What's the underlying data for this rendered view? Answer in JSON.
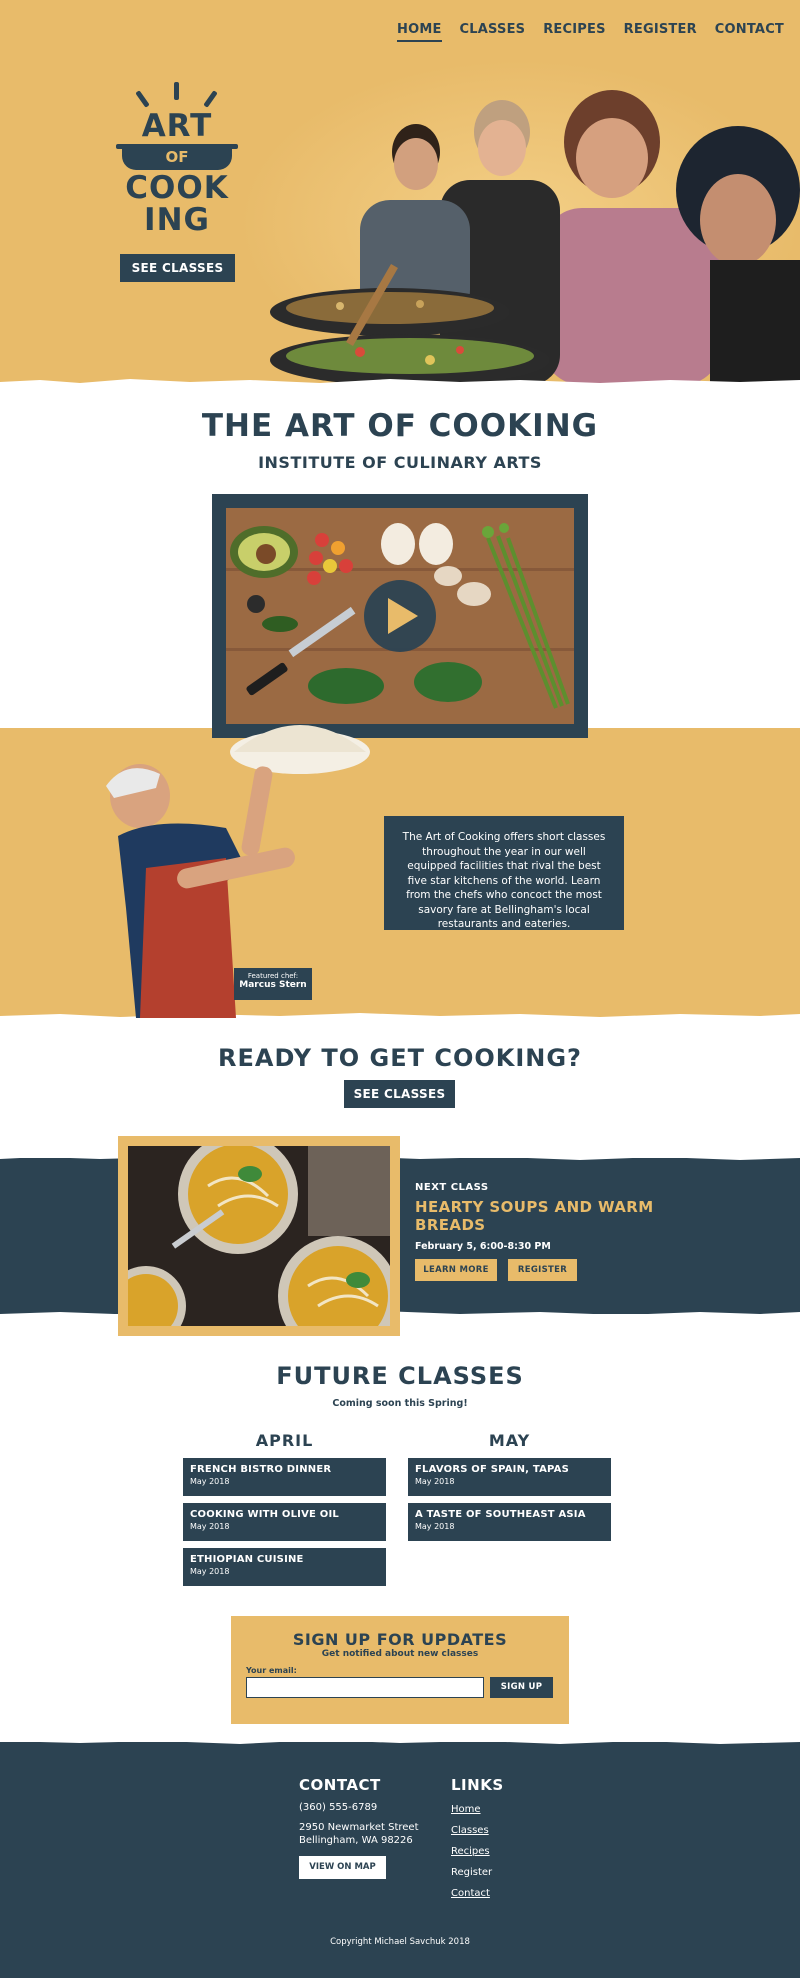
{
  "nav": {
    "items": [
      {
        "label": "HOME",
        "active": true
      },
      {
        "label": "CLASSES"
      },
      {
        "label": "RECIPES"
      },
      {
        "label": "REGISTER"
      },
      {
        "label": "CONTACT"
      }
    ]
  },
  "hero": {
    "logo_line1": "ART",
    "logo_line2": "OF",
    "logo_line3": "COOK",
    "logo_line4": "ING",
    "cta": "SEE CLASSES"
  },
  "intro": {
    "title": "THE ART OF COOKING",
    "subtitle": "INSTITUTE OF CULINARY ARTS"
  },
  "about": {
    "text": "The Art of Cooking offers short classes throughout the year in our well equipped facilities that rival the best five star kitchens of the world. Learn from the chefs who concoct the most savory fare at Bellingham's local restaurants and eateries.",
    "caption_label": "Featured chef:",
    "caption_name": "Marcus Stern"
  },
  "ready": {
    "title": "READY TO GET COOKING?",
    "cta": "SEE CLASSES"
  },
  "next_class": {
    "kicker": "NEXT CLASS",
    "title_line1": "HEARTY SOUPS AND WARM",
    "title_line2": "BREADS",
    "date": "February 5, 6:00-8:30 PM",
    "learn_more": "LEARN MORE",
    "register": "REGISTER"
  },
  "future": {
    "title": "FUTURE CLASSES",
    "subtitle": "Coming soon this Spring!",
    "april": {
      "label": "APRIL",
      "classes": [
        {
          "title": "FRENCH BISTRO DINNER",
          "date": "May 2018"
        },
        {
          "title": "COOKING WITH OLIVE OIL",
          "date": "May 2018"
        },
        {
          "title": "ETHIOPIAN CUISINE",
          "date": "May 2018"
        }
      ]
    },
    "may": {
      "label": "MAY",
      "classes": [
        {
          "title": "FLAVORS OF SPAIN, TAPAS",
          "date": "May 2018"
        },
        {
          "title": "A TASTE OF SOUTHEAST ASIA",
          "date": "May 2018"
        }
      ]
    }
  },
  "signup": {
    "title": "SIGN UP FOR UPDATES",
    "subtitle": "Get notified about new classes",
    "email_label": "Your email:",
    "email_value": "",
    "button": "SIGN UP"
  },
  "footer": {
    "contact_title": "CONTACT",
    "phone": "(360) 555-6789",
    "address1": "2950 Newmarket Street",
    "address2": "Bellingham, WA 98226",
    "map_button": "VIEW ON MAP",
    "links_title": "LINKS",
    "links": [
      "Home",
      "Classes",
      "Recipes",
      "Register",
      "Contact"
    ],
    "copyright": "Copyright Michael Savchuk 2018"
  },
  "colors": {
    "gold": "#e8bb6a",
    "navy": "#2c4352",
    "white": "#ffffff"
  },
  "icons": {
    "video_play": "play-icon"
  }
}
